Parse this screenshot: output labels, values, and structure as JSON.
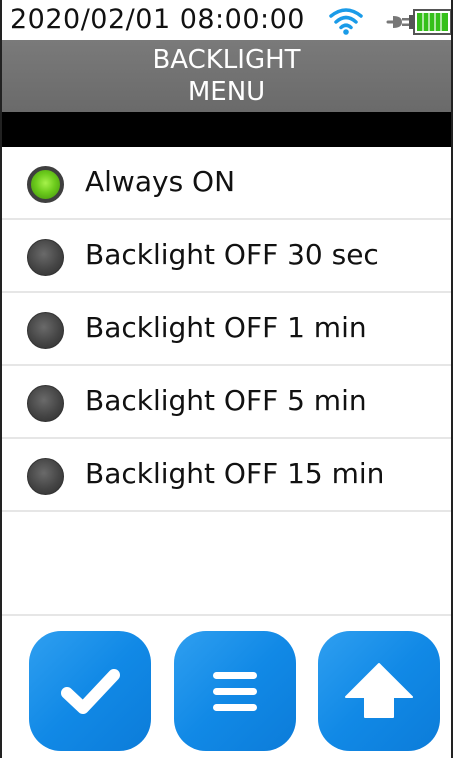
{
  "status_bar": {
    "datetime": "2020/02/01 08:00:00",
    "icons": [
      "wifi-icon",
      "plug-icon",
      "battery-icon"
    ],
    "wifi_color": "#1a9be8",
    "battery_color": "#35c01a"
  },
  "header": {
    "title_line1": "BACKLIGHT",
    "title_line2": "MENU"
  },
  "menu": {
    "items": [
      {
        "label": "Always ON",
        "selected": true
      },
      {
        "label": "Backlight OFF 30 sec",
        "selected": false
      },
      {
        "label": "Backlight OFF 1 min",
        "selected": false
      },
      {
        "label": "Backlight OFF 5 min",
        "selected": false
      },
      {
        "label": "Backlight OFF 15 min",
        "selected": false
      }
    ]
  },
  "footer": {
    "buttons": [
      {
        "icon": "checkmark-icon"
      },
      {
        "icon": "menu-icon"
      },
      {
        "icon": "up-arrow-icon"
      }
    ],
    "accent": "#1a8ae6"
  }
}
